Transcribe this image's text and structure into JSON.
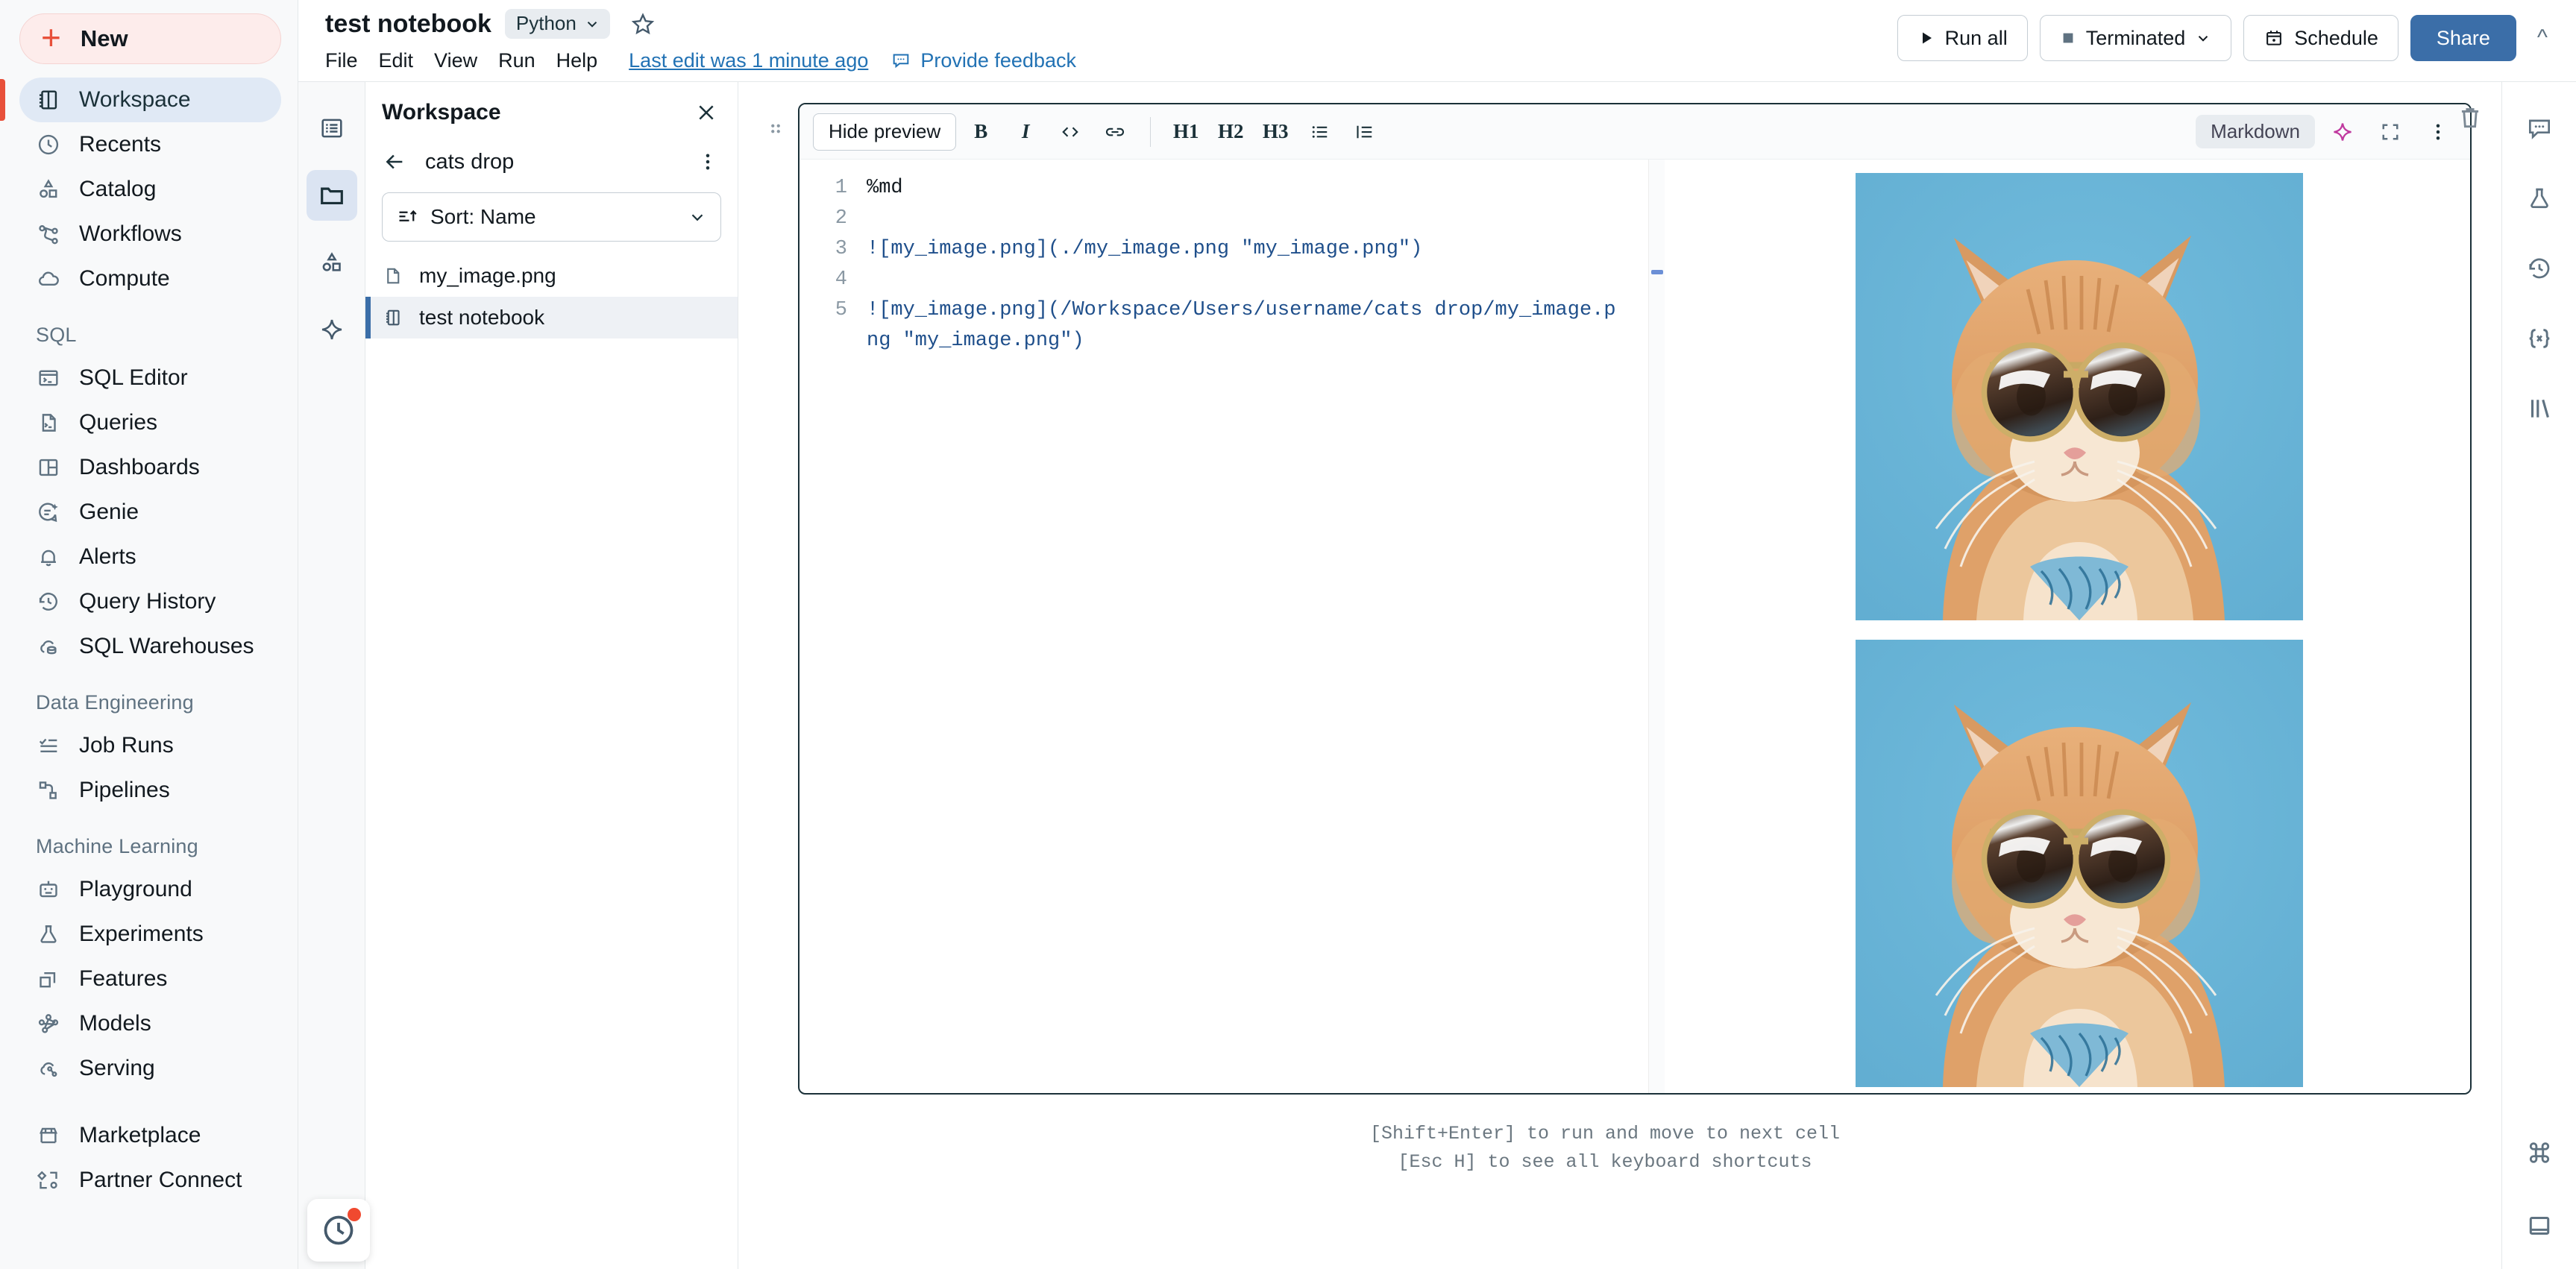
{
  "sidebar": {
    "new_button": {
      "label": "New",
      "icon": "plus-icon"
    },
    "primary_items": [
      {
        "label": "Workspace",
        "icon": "workspace-icon",
        "active": true
      },
      {
        "label": "Recents",
        "icon": "clock-icon",
        "active": false
      },
      {
        "label": "Catalog",
        "icon": "catalog-icon",
        "active": false
      },
      {
        "label": "Workflows",
        "icon": "workflows-icon",
        "active": false
      },
      {
        "label": "Compute",
        "icon": "cloud-icon",
        "active": false
      }
    ],
    "groups": [
      {
        "title": "SQL",
        "items": [
          {
            "label": "SQL Editor",
            "icon": "sql-editor-icon"
          },
          {
            "label": "Queries",
            "icon": "queries-icon"
          },
          {
            "label": "Dashboards",
            "icon": "dashboards-icon"
          },
          {
            "label": "Genie",
            "icon": "genie-icon"
          },
          {
            "label": "Alerts",
            "icon": "bell-icon"
          },
          {
            "label": "Query History",
            "icon": "history-icon"
          },
          {
            "label": "SQL Warehouses",
            "icon": "warehouse-icon"
          }
        ]
      },
      {
        "title": "Data Engineering",
        "items": [
          {
            "label": "Job Runs",
            "icon": "job-runs-icon"
          },
          {
            "label": "Pipelines",
            "icon": "pipelines-icon"
          }
        ]
      },
      {
        "title": "Machine Learning",
        "items": [
          {
            "label": "Playground",
            "icon": "robot-icon"
          },
          {
            "label": "Experiments",
            "icon": "flask-icon"
          },
          {
            "label": "Features",
            "icon": "features-icon"
          },
          {
            "label": "Models",
            "icon": "models-icon"
          },
          {
            "label": "Serving",
            "icon": "serving-icon"
          }
        ]
      }
    ],
    "footer_items": [
      {
        "label": "Marketplace",
        "icon": "marketplace-icon"
      },
      {
        "label": "Partner Connect",
        "icon": "partner-connect-icon"
      }
    ],
    "clock_badge": {
      "icon": "clock-icon",
      "has_notification": true
    }
  },
  "header": {
    "notebook_title": "test notebook",
    "language": "Python",
    "menus": [
      "File",
      "Edit",
      "View",
      "Run",
      "Help"
    ],
    "last_edit": "Last edit was 1 minute ago",
    "feedback": "Provide feedback",
    "run_all": "Run all",
    "cluster_status": "Terminated",
    "schedule": "Schedule",
    "share": "Share"
  },
  "workspace_panel": {
    "title": "Workspace",
    "breadcrumb_folder": "cats drop",
    "sort_label": "Sort: Name",
    "items": [
      {
        "name": "my_image.png",
        "icon": "file-icon",
        "selected": false
      },
      {
        "name": "test notebook",
        "icon": "notebook-icon",
        "selected": true
      }
    ],
    "rail_icons": [
      "list-icon",
      "folder-icon",
      "catalog-icon",
      "sparkle-icon"
    ]
  },
  "cell": {
    "toolbar": {
      "hide_preview": "Hide preview",
      "bold": "B",
      "italic": "I",
      "code": "<>",
      "link": "link-icon",
      "h1": "H1",
      "h2": "H2",
      "h3": "H3",
      "bullet_list": "bullet-list-icon",
      "numbered_list": "numbered-list-icon",
      "language_pill": "Markdown",
      "assistant": "sparkle-icon",
      "fullscreen": "fullscreen-icon",
      "more": "kebab-icon"
    },
    "code": [
      {
        "n": "1",
        "text": "%md",
        "cmd": true
      },
      {
        "n": "2",
        "text": "",
        "cmd": false
      },
      {
        "n": "3",
        "text": "![my_image.png](./my_image.png \"my_image.png\")",
        "cmd": false
      },
      {
        "n": "4",
        "text": "",
        "cmd": false
      },
      {
        "n": "5",
        "text": "![my_image.png](/Workspace/Users/username/cats drop/my_image.png \"my_image.png\")",
        "cmd": false
      }
    ],
    "preview_images": [
      {
        "alt": "orange cat wearing aviator sunglasses on blue background"
      },
      {
        "alt": "orange cat wearing aviator sunglasses on blue background"
      }
    ],
    "delete": "trash-icon"
  },
  "hints": {
    "line1": "[Shift+Enter] to run and move to next cell",
    "line2": "[Esc H] to see all keyboard shortcuts"
  },
  "right_rail": {
    "items": [
      "comment-icon",
      "flask-icon",
      "history-icon",
      "variables-icon",
      "library-icon"
    ],
    "bottom_items": [
      "command-icon",
      "panel-icon"
    ]
  },
  "colors": {
    "accent_red": "#e8503a",
    "accent_blue": "#3b6ea8",
    "link_blue": "#2272b4",
    "cat_bg": "#68b4d6",
    "sidebar_bg": "#f8f9fa",
    "cell_border": "#1b3139"
  }
}
